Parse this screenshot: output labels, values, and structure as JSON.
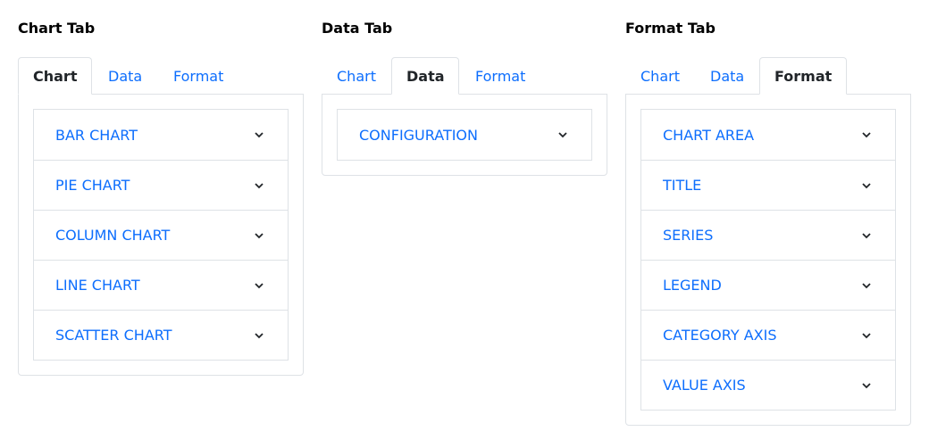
{
  "panels": [
    {
      "title": "Chart Tab",
      "tabs": [
        "Chart",
        "Data",
        "Format"
      ],
      "active_tab": "Chart",
      "items": [
        "BAR CHART",
        "PIE CHART",
        "COLUMN CHART",
        "LINE CHART",
        "SCATTER CHART"
      ]
    },
    {
      "title": "Data Tab",
      "tabs": [
        "Chart",
        "Data",
        "Format"
      ],
      "active_tab": "Data",
      "items": [
        "CONFIGURATION"
      ]
    },
    {
      "title": "Format Tab",
      "tabs": [
        "Chart",
        "Data",
        "Format"
      ],
      "active_tab": "Format",
      "items": [
        "CHART AREA",
        "TITLE",
        "SERIES",
        "LEGEND",
        "CATEGORY AXIS",
        "VALUE AXIS"
      ]
    }
  ],
  "icons": {
    "expand": "chevron-down-icon"
  },
  "colors": {
    "link": "#0d6efd",
    "border": "#dee2e6",
    "active_text": "#212529"
  }
}
